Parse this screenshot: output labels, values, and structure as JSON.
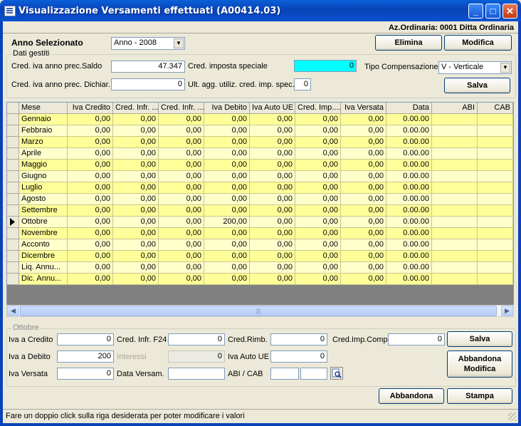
{
  "window": {
    "title": "Visualizzazione Versamenti effettuati (A00414.03)",
    "company": "Az.Ordinaria: 0001 Ditta Ordinaria"
  },
  "header": {
    "anno_label": "Anno Selezionato",
    "anno_value": "Anno  - 2008",
    "elimina_label": "Elimina",
    "modifica_label": "Modifica"
  },
  "dati_gestiti": {
    "group_title": "Dati gestiti",
    "cred_saldo_label": "Cred. iva anno prec.Saldo",
    "cred_saldo_value": "47.347",
    "cred_speciale_label": "Cred. imposta speciale",
    "cred_speciale_value": "0",
    "tipo_comp_label": "Tipo Compensazione",
    "tipo_comp_value": "V - Verticale",
    "cred_dichiar_label": "Cred. iva anno prec. Dichiar.",
    "cred_dichiar_value": "0",
    "ult_agg_label": "Ult. agg. utiliz. cred. imp. spec.",
    "ult_agg_value": "0",
    "salva_label": "Salva"
  },
  "grid": {
    "columns": [
      "Mese",
      "Iva Credito",
      "Cred. Infr. ...",
      "Cred. Infr. ...",
      "Iva Debito",
      "Iva Auto UE",
      "Cred. Imp....",
      "Iva Versata",
      "Data",
      "ABI",
      "CAB"
    ],
    "current_row": 9,
    "rows": [
      [
        "Gennaio",
        "0,00",
        "0,00",
        "0,00",
        "0,00",
        "0,00",
        "0,00",
        "0,00",
        "0.00.00",
        "",
        ""
      ],
      [
        "Febbraio",
        "0,00",
        "0,00",
        "0,00",
        "0,00",
        "0,00",
        "0,00",
        "0,00",
        "0.00.00",
        "",
        ""
      ],
      [
        "Marzo",
        "0,00",
        "0,00",
        "0,00",
        "0,00",
        "0,00",
        "0,00",
        "0,00",
        "0.00.00",
        "",
        ""
      ],
      [
        "Aprile",
        "0,00",
        "0,00",
        "0,00",
        "0,00",
        "0,00",
        "0,00",
        "0,00",
        "0.00.00",
        "",
        ""
      ],
      [
        "Maggio",
        "0,00",
        "0,00",
        "0,00",
        "0,00",
        "0,00",
        "0,00",
        "0,00",
        "0.00.00",
        "",
        ""
      ],
      [
        "Giugno",
        "0,00",
        "0,00",
        "0,00",
        "0,00",
        "0,00",
        "0,00",
        "0,00",
        "0.00.00",
        "",
        ""
      ],
      [
        "Luglio",
        "0,00",
        "0,00",
        "0,00",
        "0,00",
        "0,00",
        "0,00",
        "0,00",
        "0.00.00",
        "",
        ""
      ],
      [
        "Agosto",
        "0,00",
        "0,00",
        "0,00",
        "0,00",
        "0,00",
        "0,00",
        "0,00",
        "0.00.00",
        "",
        ""
      ],
      [
        "Settembre",
        "0,00",
        "0,00",
        "0,00",
        "0,00",
        "0,00",
        "0,00",
        "0,00",
        "0.00.00",
        "",
        ""
      ],
      [
        "Ottobre",
        "0,00",
        "0,00",
        "0,00",
        "200,00",
        "0,00",
        "0,00",
        "0,00",
        "0.00.00",
        "",
        ""
      ],
      [
        "Novembre",
        "0,00",
        "0,00",
        "0,00",
        "0,00",
        "0,00",
        "0,00",
        "0,00",
        "0.00.00",
        "",
        ""
      ],
      [
        "Acconto",
        "0,00",
        "0,00",
        "0,00",
        "0,00",
        "0,00",
        "0,00",
        "0,00",
        "0.00.00",
        "",
        ""
      ],
      [
        "Dicembre",
        "0,00",
        "0,00",
        "0,00",
        "0,00",
        "0,00",
        "0,00",
        "0,00",
        "0.00.00",
        "",
        ""
      ],
      [
        "Liq. Annu...",
        "0,00",
        "0,00",
        "0,00",
        "0,00",
        "0,00",
        "0,00",
        "0,00",
        "0.00.00",
        "",
        ""
      ],
      [
        "Dic. Annu...",
        "0,00",
        "0,00",
        "0,00",
        "0,00",
        "0,00",
        "0,00",
        "0,00",
        "0.00.00",
        "",
        ""
      ]
    ]
  },
  "detail": {
    "group_title": "Ottobre",
    "iva_credito_label": "Iva a Credito",
    "iva_credito_value": "0",
    "cred_infr_label": "Cred. Infr. F24",
    "cred_infr_value": "0",
    "cred_rimb_label": "Cred.Rimb.",
    "cred_rimb_value": "0",
    "cred_imp_comp_label": "Cred.Imp.Comp.",
    "cred_imp_comp_value": "0",
    "iva_debito_label": "Iva a Debito",
    "iva_debito_value": "200",
    "interessi_label": "Interessi",
    "interessi_value": "0",
    "iva_auto_ue_label": "Iva Auto UE",
    "iva_auto_ue_value": "0",
    "iva_versata_label": "Iva Versata",
    "iva_versata_value": "0",
    "data_versam_label": "Data Versam.",
    "data_versam_value": "",
    "abi_cab_label": "ABI / CAB",
    "abi_value": "",
    "cab_value": "",
    "salva_label": "Salva",
    "abbandona_modifica_label_1": "Abbandona",
    "abbandona_modifica_label_2": "Modifica"
  },
  "footer": {
    "abbandona_label": "Abbandona",
    "stampa_label": "Stampa",
    "status_text": "Fare un doppio click sulla riga desiderata per poter modificare i valori"
  },
  "colors": {
    "titlebar": "#0843b8",
    "row_odd": "#ffff99",
    "row_even": "#ffffcc",
    "highlight_field": "#00ffff",
    "grid_background": "#808080"
  }
}
